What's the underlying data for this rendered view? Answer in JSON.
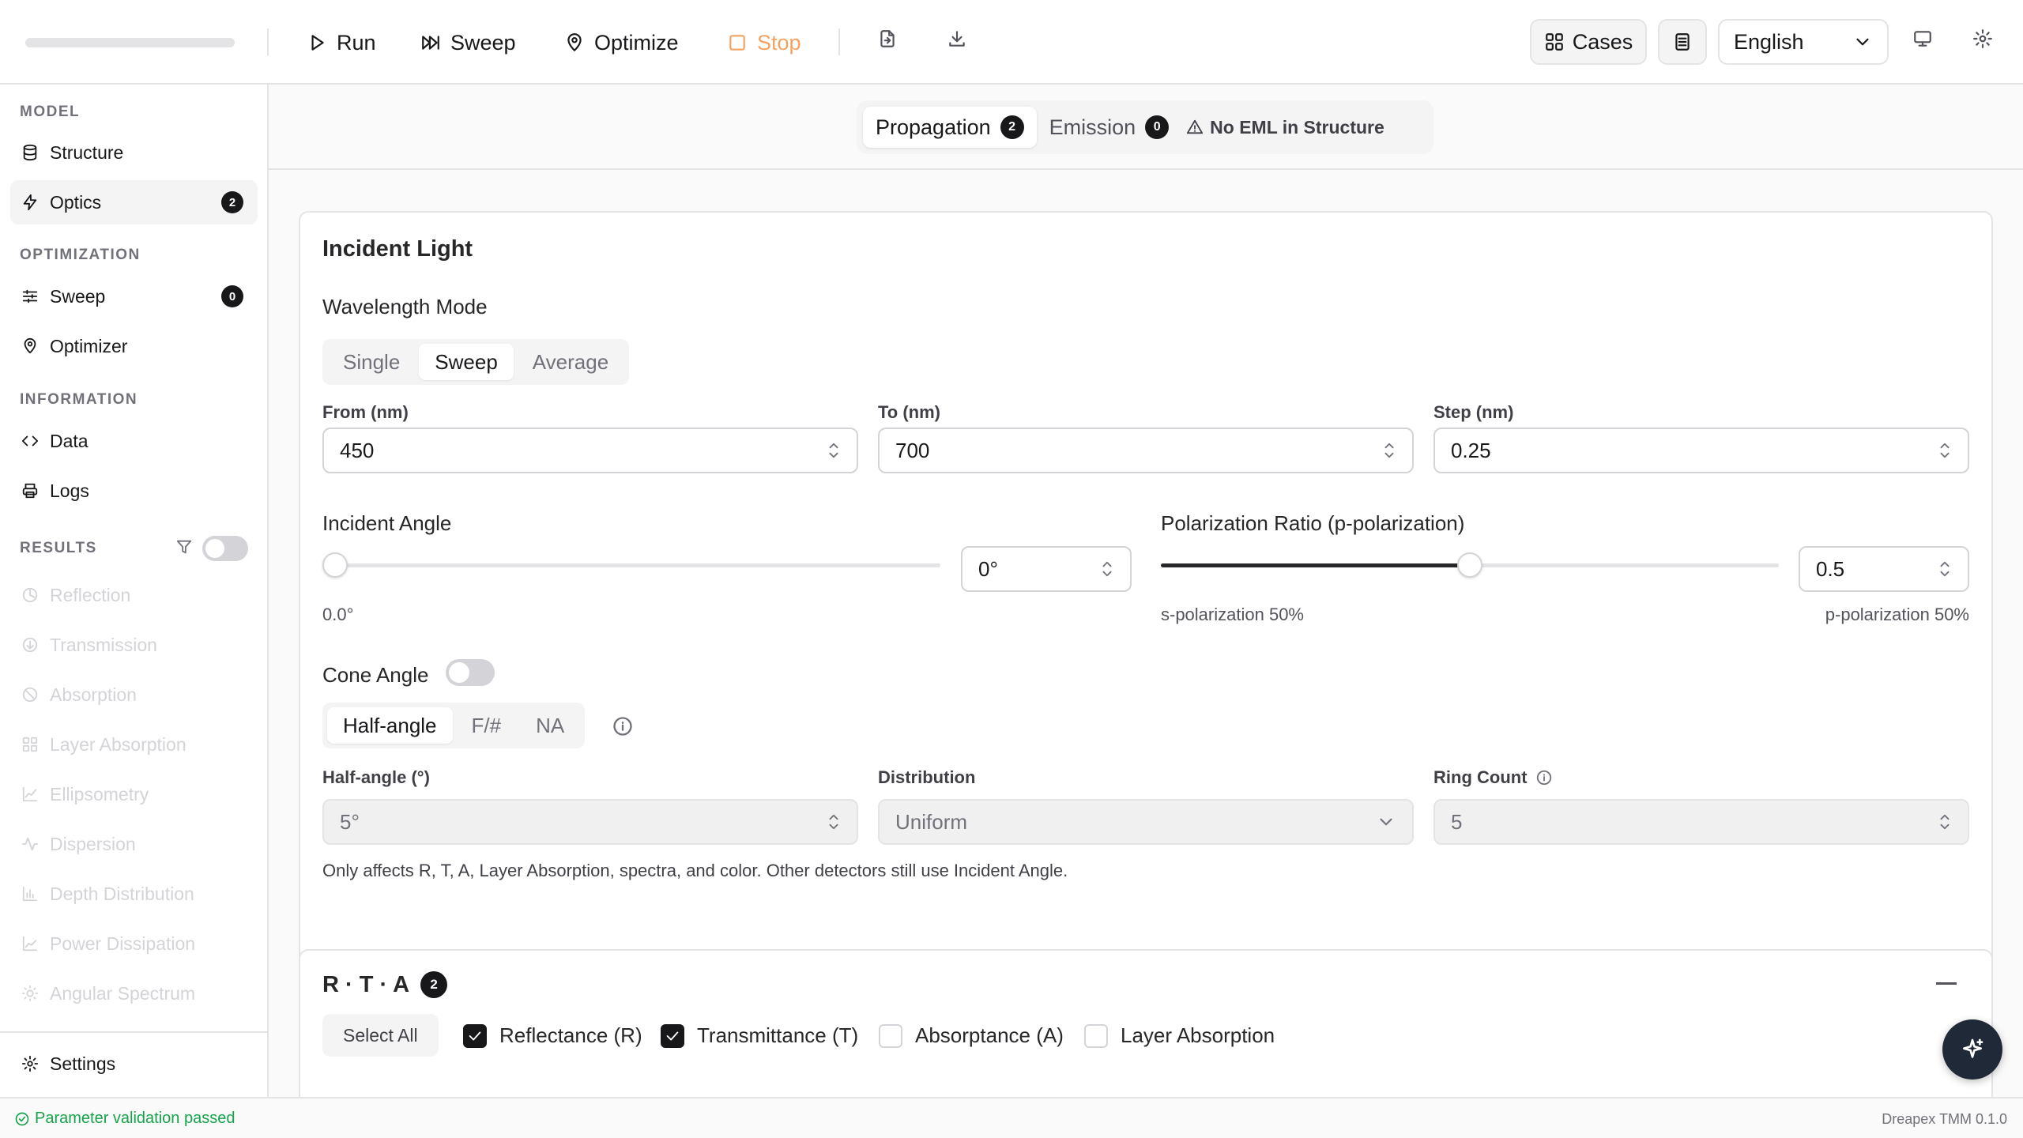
{
  "toolbar": {
    "run": "Run",
    "sweep": "Sweep",
    "optimize": "Optimize",
    "stop": "Stop",
    "cases": "Cases",
    "language": "English",
    "icons": [
      "play-icon",
      "skip-forward-icon",
      "map-pin-icon",
      "square-icon",
      "import-icon",
      "download-icon",
      "grid-icon",
      "document-icon",
      "chevron-down-icon",
      "monitor-icon",
      "gear-icon"
    ]
  },
  "sidebar": {
    "sections": {
      "model": "MODEL",
      "optimization": "OPTIMIZATION",
      "information": "INFORMATION",
      "results": "RESULTS"
    },
    "model_items": [
      {
        "label": "Structure"
      },
      {
        "label": "Optics",
        "badge": "2",
        "active": true
      }
    ],
    "optimization_items": [
      {
        "label": "Sweep",
        "badge": "0"
      },
      {
        "label": "Optimizer"
      }
    ],
    "information_items": [
      {
        "label": "Data"
      },
      {
        "label": "Logs"
      }
    ],
    "results_items": [
      "Reflection",
      "Transmission",
      "Absorption",
      "Layer Absorption",
      "Ellipsometry",
      "Dispersion",
      "Depth Distribution",
      "Power Dissipation",
      "Angular Spectrum"
    ],
    "results_filter_enabled": false,
    "settings": "Settings"
  },
  "tabs": {
    "propagation": "Propagation",
    "propagation_badge": "2",
    "emission": "Emission",
    "emission_badge": "0",
    "warning": "No EML in Structure"
  },
  "incident": {
    "title": "Incident Light",
    "wavelength_mode_label": "Wavelength Mode",
    "modes": [
      "Single",
      "Sweep",
      "Average"
    ],
    "selected_mode": "Sweep",
    "from_label": "From (nm)",
    "from_value": "450",
    "to_label": "To (nm)",
    "to_value": "700",
    "step_label": "Step (nm)",
    "step_value": "0.25",
    "angle_label": "Incident Angle",
    "angle_input": "0°",
    "angle_value_deg": 0,
    "angle_hint": "0.0°",
    "pol_label": "Polarization Ratio (p-polarization)",
    "pol_input": "0.5",
    "pol_value": 0.5,
    "s_hint": "s-polarization 50%",
    "p_hint": "p-polarization 50%",
    "cone_label": "Cone Angle",
    "cone_enabled": false,
    "cone_modes": [
      "Half-angle",
      "F/#",
      "NA"
    ],
    "selected_cone_mode": "Half-angle",
    "half_angle_label": "Half-angle (°)",
    "half_angle_value": "5°",
    "distribution_label": "Distribution",
    "distribution_value": "Uniform",
    "ring_label": "Ring Count",
    "ring_value": "5",
    "note": "Only affects R, T, A, Layer Absorption, spectra, and color. Other detectors still use Incident Angle."
  },
  "rta": {
    "title": "R · T · A",
    "badge": "2",
    "select_all": "Select All",
    "options": [
      {
        "label": "Reflectance (R)",
        "checked": true
      },
      {
        "label": "Transmittance (T)",
        "checked": true
      },
      {
        "label": "Absorptance (A)",
        "checked": false
      },
      {
        "label": "Layer Absorption",
        "checked": false
      }
    ]
  },
  "status": {
    "message": "Parameter validation passed",
    "version": "Dreapex TMM 0.1.0"
  },
  "colors": {
    "accent": "#18181b",
    "stop": "#f4a261",
    "ok": "#16a34a"
  }
}
